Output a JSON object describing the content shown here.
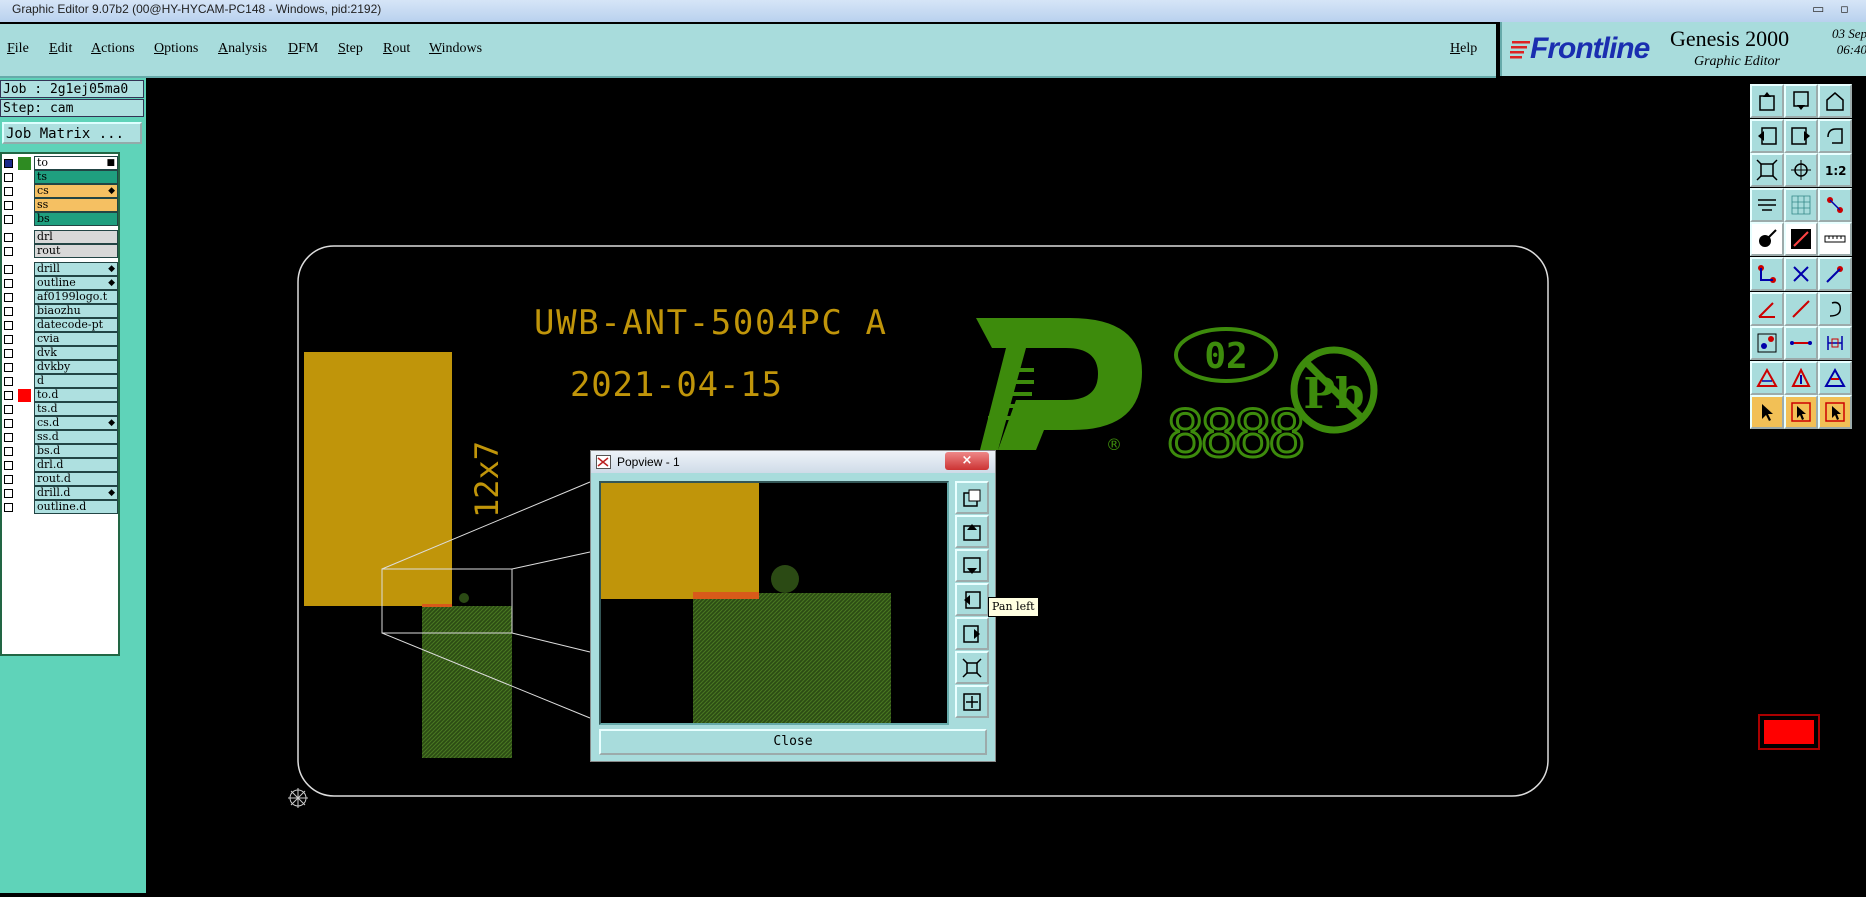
{
  "window": {
    "title": "Graphic Editor 9.07b2 (00@HY-HYCAM-PC148 - Windows, pid:2192)"
  },
  "menu": {
    "items": [
      "File",
      "Edit",
      "Actions",
      "Options",
      "Analysis",
      "DFM",
      "Step",
      "Rout",
      "Windows"
    ],
    "help": "Help"
  },
  "brand": {
    "logo": "Frontline",
    "product": "Genesis 2000",
    "module": "Graphic Editor",
    "date": "03 Sep",
    "time": "06:40"
  },
  "info": {
    "job": "Job : 2g1ej05ma0",
    "step": "Step: cam",
    "job_matrix": "Job Matrix ..."
  },
  "layers": [
    {
      "name": "to",
      "bg": "#ffffff",
      "swatch": "#2e8b22",
      "cb": "#1b2b8a",
      "icon": "■"
    },
    {
      "name": "ts",
      "bg": "#1f9f7f",
      "swatch": "",
      "cb": "",
      "icon": ""
    },
    {
      "name": "cs",
      "bg": "#f5c062",
      "swatch": "",
      "cb": "",
      "icon": "◆"
    },
    {
      "name": "ss",
      "bg": "#f5c062",
      "swatch": "",
      "cb": "",
      "icon": ""
    },
    {
      "name": "bs",
      "bg": "#1f9f7f",
      "swatch": "",
      "cb": "",
      "icon": ""
    },
    {
      "name": "drl",
      "bg": "#d8d8d8",
      "swatch": "",
      "cb": "",
      "icon": ""
    },
    {
      "name": "rout",
      "bg": "#d8d8d8",
      "swatch": "",
      "cb": "",
      "icon": ""
    },
    {
      "name": "drill",
      "bg": "#aee0e0",
      "swatch": "",
      "cb": "",
      "icon": "◆"
    },
    {
      "name": "outline",
      "bg": "#aee0e0",
      "swatch": "",
      "cb": "",
      "icon": "◆"
    },
    {
      "name": "af0199logo.t",
      "bg": "#aee0e0",
      "swatch": "",
      "cb": "",
      "icon": ""
    },
    {
      "name": "biaozhu",
      "bg": "#aee0e0",
      "swatch": "",
      "cb": "",
      "icon": ""
    },
    {
      "name": "datecode-pt",
      "bg": "#aee0e0",
      "swatch": "",
      "cb": "",
      "icon": ""
    },
    {
      "name": "cvia",
      "bg": "#aee0e0",
      "swatch": "",
      "cb": "",
      "icon": ""
    },
    {
      "name": "dvk",
      "bg": "#aee0e0",
      "swatch": "",
      "cb": "",
      "icon": ""
    },
    {
      "name": "dvkby",
      "bg": "#aee0e0",
      "swatch": "",
      "cb": "",
      "icon": ""
    },
    {
      "name": "d",
      "bg": "#aee0e0",
      "swatch": "",
      "cb": "",
      "icon": ""
    },
    {
      "name": "to.d",
      "bg": "#aee0e0",
      "swatch": "#ff0000",
      "cb": "",
      "icon": ""
    },
    {
      "name": "ts.d",
      "bg": "#aee0e0",
      "swatch": "",
      "cb": "",
      "icon": ""
    },
    {
      "name": "cs.d",
      "bg": "#aee0e0",
      "swatch": "",
      "cb": "",
      "icon": "◆"
    },
    {
      "name": "ss.d",
      "bg": "#aee0e0",
      "swatch": "",
      "cb": "",
      "icon": ""
    },
    {
      "name": "bs.d",
      "bg": "#aee0e0",
      "swatch": "",
      "cb": "",
      "icon": ""
    },
    {
      "name": "drl.d",
      "bg": "#aee0e0",
      "swatch": "",
      "cb": "",
      "icon": ""
    },
    {
      "name": "rout.d",
      "bg": "#aee0e0",
      "swatch": "",
      "cb": "",
      "icon": ""
    },
    {
      "name": "drill.d",
      "bg": "#aee0e0",
      "swatch": "",
      "cb": "",
      "icon": "◆"
    },
    {
      "name": "outline.d",
      "bg": "#aee0e0",
      "swatch": "",
      "cb": "",
      "icon": ""
    }
  ],
  "board": {
    "part": "UWB-ANT-5004PC A",
    "date": "2021-04-15",
    "size": "12x7",
    "rev": "02",
    "code": "8888",
    "pb": "Pb",
    "reg": "®"
  },
  "popview": {
    "title": "Popview - 1",
    "close": "Close",
    "close_x": "×",
    "tooltip": "Pan left"
  },
  "colors": {
    "gold": "#c0950a",
    "green": "#3d8b0c",
    "dark_green": "#2b4a14",
    "panel": "#a8dcdc",
    "left_panel": "#5fd3b9"
  },
  "toolbar_icons": [
    "zoom-in-icon",
    "zoom-out-icon",
    "home-icon",
    "pan-left-icon",
    "pan-right-icon",
    "undo-icon",
    "fit-icon",
    "center-icon",
    "scale-icon",
    "measure-icon",
    "grid-icon",
    "snap-icon",
    "pad-icon",
    "line-icon",
    "ruler-icon",
    "nodes-icon",
    "cross-icon",
    "point-icon",
    "angle-icon",
    "diag-icon",
    "arc-icon",
    "split-icon",
    "segment-icon",
    "bracket-icon",
    "triangle-icon",
    "arrow-up-icon",
    "triangle-alt-icon",
    "select-icon",
    "select-alt-icon",
    "select-box-icon"
  ]
}
